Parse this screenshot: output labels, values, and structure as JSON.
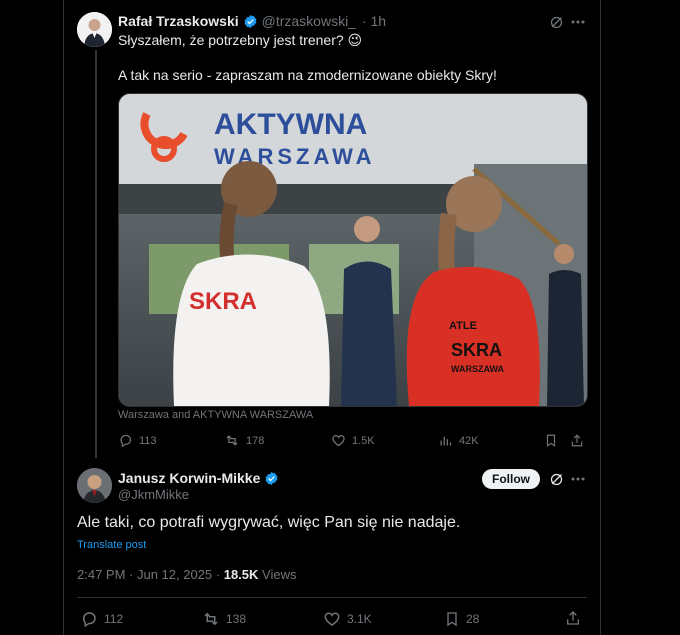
{
  "tweet1": {
    "name": "Rafał Trzaskowski",
    "handle": "@trzaskowski_",
    "time": "· 1h",
    "line1": "Słyszałem, że potrzebny jest trener? 😉",
    "line2": "A tak na serio - zapraszam na zmodernizowane obiekty Skry!",
    "image_caption": "Warszawa and AKTYWNA WARSZAWA",
    "sign_text_line1": "AKTYWNA",
    "sign_text_line2": "WARSZAWA",
    "shirt_text": "SKRA",
    "jacket_text_1": "ATLE",
    "jacket_text_2": "SKRA",
    "jacket_text_3": "WARSZAWA",
    "replies": "113",
    "reposts": "178",
    "likes": "1.5K",
    "views": "42K"
  },
  "tweet2": {
    "name": "Janusz Korwin-Mikke",
    "handle": "@JkmMikke",
    "follow_label": "Follow",
    "text": "Ale taki, co potrafi wygrywać, więc Pan się nie nadaje.",
    "translate_label": "Translate post",
    "timestamp": "2:47 PM · Jun 12, 2025 ·",
    "views_count": "18.5K",
    "views_label": "Views",
    "replies": "112",
    "reposts": "138",
    "likes": "3.1K",
    "bookmarks": "28"
  },
  "colors": {
    "background": "#000000",
    "text": "#e7e9ea",
    "muted": "#71767b",
    "accent": "#1d9bf0",
    "verified": "#1d9bf0",
    "border": "#2f3336"
  },
  "icons": [
    "grok-icon",
    "more-icon",
    "verified-icon",
    "reply-icon",
    "repost-icon",
    "like-icon",
    "views-icon",
    "bookmark-icon",
    "share-icon"
  ]
}
